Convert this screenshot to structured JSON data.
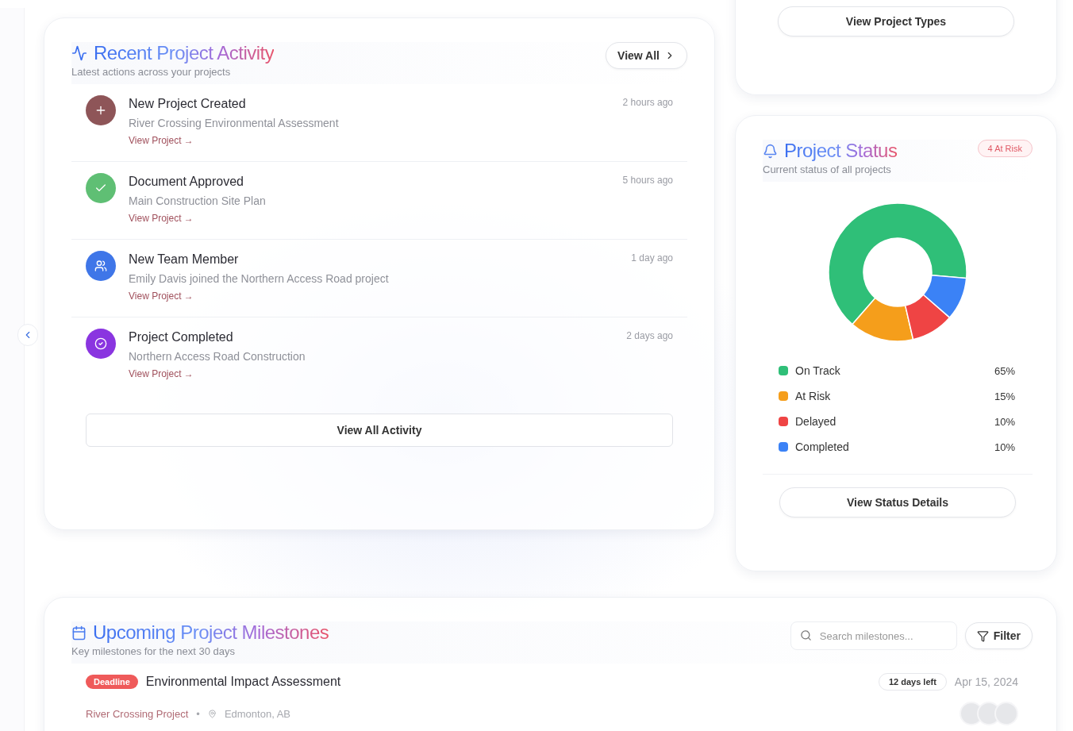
{
  "top_card": {
    "button": "View Project Types"
  },
  "activity": {
    "title": "Recent Project Activity",
    "subtitle": "Latest actions across your projects",
    "view_all": "View All",
    "items": [
      {
        "kind": "created",
        "color": "#8e5558",
        "title": "New Project Created",
        "detail": "River Crossing Environmental Assessment",
        "link": "View Project →",
        "time": "2 hours ago"
      },
      {
        "kind": "approved",
        "color": "#5fbf74",
        "title": "Document Approved",
        "detail": "Main Construction Site Plan",
        "link": "View Project →",
        "time": "5 hours ago"
      },
      {
        "kind": "member",
        "color": "#3f76e8",
        "title": "New Team Member",
        "detail": "Emily Davis joined the Northern Access Road project",
        "link": "View Project →",
        "time": "1 day ago"
      },
      {
        "kind": "completed",
        "color": "#8a35e0",
        "title": "Project Completed",
        "detail": "Northern Access Road Construction",
        "link": "View Project →",
        "time": "2 days ago"
      }
    ],
    "footer_button": "View All Activity"
  },
  "status": {
    "title": "Project Status",
    "subtitle": "Current status of all projects",
    "badge": "4 At Risk",
    "chart_data": {
      "type": "donut",
      "categories": [
        "On Track",
        "At Risk",
        "Delayed",
        "Completed"
      ],
      "series": [
        {
          "values": [
            65,
            15,
            10,
            10
          ]
        }
      ]
    },
    "legend": [
      {
        "value": "65%",
        "color": "#2fbf78"
      },
      {
        "value": "15%",
        "color": "#f59e1b"
      },
      {
        "value": "10%",
        "color": "#ef4444"
      },
      {
        "value": "10%",
        "color": "#3b82f6"
      }
    ],
    "button": "View Status Details"
  },
  "milestones": {
    "title": "Upcoming Project Milestones",
    "subtitle": "Key milestones for the next 30 days",
    "search": {
      "placeholder": "Search milestones..."
    },
    "filter": "Filter",
    "items": [
      {
        "tag": "Deadline",
        "title": "Environmental Impact Assessment",
        "project": "River Crossing Project",
        "separator": "•",
        "location": "Edmonton, AB",
        "remaining": "12 days left",
        "date": "Apr 15, 2024"
      }
    ]
  }
}
